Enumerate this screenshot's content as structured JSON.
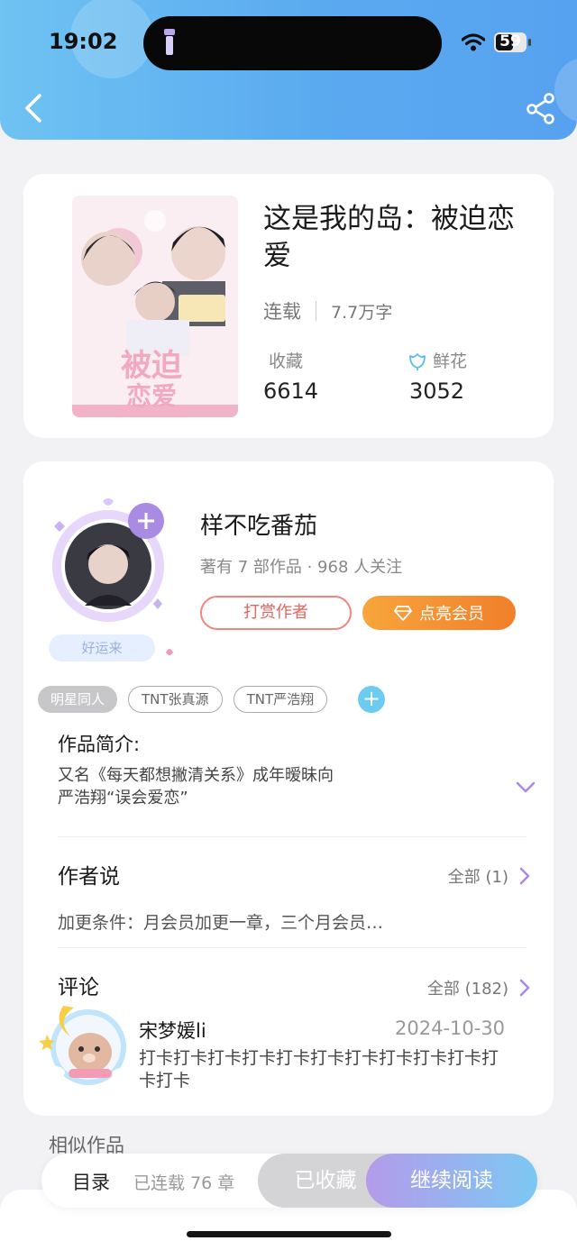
{
  "status_bar": {
    "time": "19:02",
    "battery": "59",
    "battery_level": 0.59
  },
  "header": {
    "back_icon": "chevron-left-icon",
    "share_icon": "share-icon"
  },
  "book": {
    "title": "这是我的岛：被迫恋爱",
    "status": "连载",
    "word_count": "7.7万字",
    "favorites_label": "收藏",
    "favorites_value": "6614",
    "flowers_label": "鲜花",
    "flowers_value": "3052"
  },
  "author": {
    "name": "样不吃番茄",
    "stats": "著有 7 部作品 · 968 人关注",
    "badge": "好运来",
    "reward_label": "打赏作者",
    "vip_label": "点亮会员"
  },
  "tags": [
    "明星同人",
    "TNT张真源",
    "TNT严浩翔"
  ],
  "intro": {
    "title": "作品简介:",
    "line1": "又名《每天都想撇清关系》成年暧昧向",
    "line2": "严浩翔“误会爱恋”"
  },
  "author_says": {
    "title": "作者说",
    "link": "全部 (1)",
    "text": "加更条件：月会员加更一章，三个月会员…"
  },
  "comments": {
    "title": "评论",
    "link": "全部 (182)",
    "items": [
      {
        "user": "宋梦媛li",
        "date": "2024-10-30",
        "text": "打卡打卡打卡打卡打卡打卡打卡打卡打卡打卡打卡打卡"
      }
    ]
  },
  "similar": {
    "title": "相似作品"
  },
  "bottom_bar": {
    "toc_label": "目录",
    "chapters": "已连载 76 章",
    "collected_label": "已收藏",
    "read_label": "继续阅读"
  },
  "colors": {
    "header_start": "#6ec3f2",
    "header_end": "#57a2f0",
    "accent_purple": "#a98be3",
    "reward_red": "#e5645e",
    "vip_orange": "#f39531"
  }
}
